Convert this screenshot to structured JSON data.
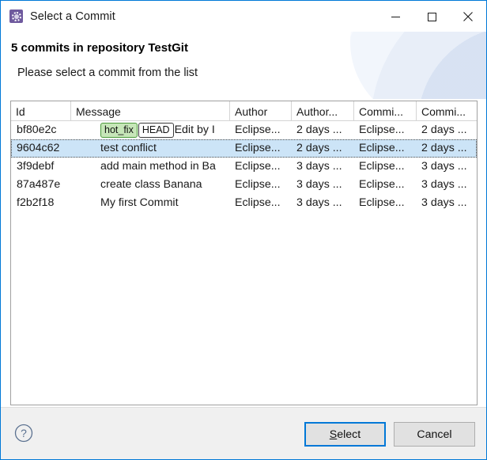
{
  "window": {
    "title": "Select a Commit",
    "icon": "commit-dialog-icon",
    "accent_color": "#0078d7",
    "controls": {
      "minimize": "Minimize",
      "maximize": "Maximize",
      "close": "Close"
    }
  },
  "header": {
    "title": "5 commits in repository TestGit",
    "subtitle": "Please select a commit from the list"
  },
  "table": {
    "columns": [
      {
        "key": "id",
        "label": "Id"
      },
      {
        "key": "message",
        "label": "Message"
      },
      {
        "key": "author",
        "label": "Author"
      },
      {
        "key": "author_date",
        "label": "Author..."
      },
      {
        "key": "committer",
        "label": "Commi..."
      },
      {
        "key": "commit_date",
        "label": "Commi..."
      }
    ],
    "rows": [
      {
        "id": "bf80e2c",
        "refs": [
          {
            "label": "hot_fix",
            "kind": "branch"
          },
          {
            "label": "HEAD",
            "kind": "head"
          }
        ],
        "message": "Edit by I",
        "author": "Eclipse...",
        "author_date": "2 days ...",
        "committer": "Eclipse...",
        "commit_date": "2 days ...",
        "selected": false
      },
      {
        "id": "9604c62",
        "refs": [],
        "message": "test conflict",
        "author": "Eclipse...",
        "author_date": "2 days ...",
        "committer": "Eclipse...",
        "commit_date": "2 days ...",
        "selected": true
      },
      {
        "id": "3f9debf",
        "refs": [],
        "message": "add main method in Ba",
        "author": "Eclipse...",
        "author_date": "3 days ...",
        "committer": "Eclipse...",
        "commit_date": "3 days ...",
        "selected": false
      },
      {
        "id": "87a487e",
        "refs": [],
        "message": "create class Banana",
        "author": "Eclipse...",
        "author_date": "3 days ...",
        "committer": "Eclipse...",
        "commit_date": "3 days ...",
        "selected": false
      },
      {
        "id": "f2b2f18",
        "refs": [],
        "message": "My first Commit",
        "author": "Eclipse...",
        "author_date": "3 days ...",
        "committer": "Eclipse...",
        "commit_date": "3 days ...",
        "selected": false
      }
    ]
  },
  "footer": {
    "help": "?",
    "select_label_prefix": "",
    "select_mnemonic": "S",
    "select_label_rest": "elect",
    "cancel_label": "Cancel"
  }
}
